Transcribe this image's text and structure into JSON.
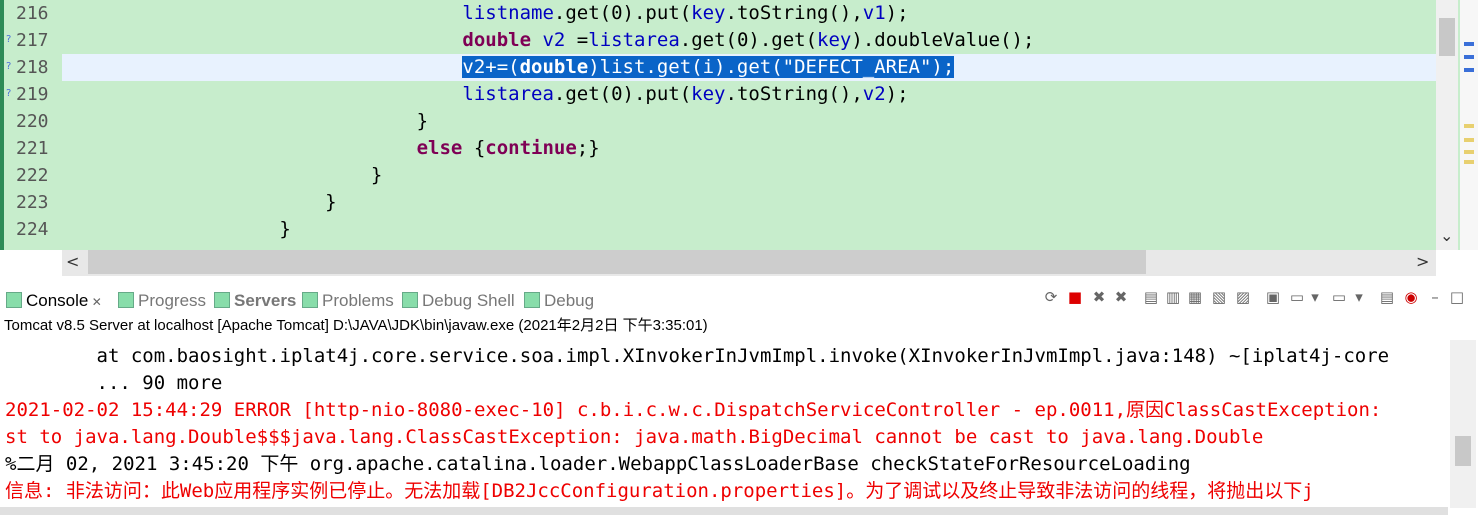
{
  "editor": {
    "line_numbers": [
      "216",
      "217",
      "218",
      "219",
      "220",
      "221",
      "222",
      "223",
      "224"
    ],
    "lines": [
      {
        "indent": "                                   ",
        "parts": [
          {
            "t": "listname",
            "c": "fld"
          },
          {
            "t": ".get(0).put(",
            "c": ""
          },
          {
            "t": "key",
            "c": "fld"
          },
          {
            "t": ".toString(),",
            "c": ""
          },
          {
            "t": "v1",
            "c": "fld"
          },
          {
            "t": ");",
            "c": ""
          }
        ]
      },
      {
        "indent": "                                   ",
        "parts": [
          {
            "t": "double",
            "c": "kw"
          },
          {
            "t": " ",
            "c": ""
          },
          {
            "t": "v2",
            "c": "fld"
          },
          {
            "t": " =",
            "c": ""
          },
          {
            "t": "listarea",
            "c": "fld"
          },
          {
            "t": ".get(0).get(",
            "c": ""
          },
          {
            "t": "key",
            "c": "fld"
          },
          {
            "t": ").doubleValue();",
            "c": ""
          }
        ]
      },
      {
        "indent": "                                   ",
        "parts": [
          {
            "t": "v2+=(",
            "c": "sel"
          },
          {
            "t": "double",
            "c": "sel kwsel"
          },
          {
            "t": ")list.get(i).get(\"DEFECT_AREA\");",
            "c": "sel"
          }
        ],
        "current": true
      },
      {
        "indent": "                                   ",
        "parts": [
          {
            "t": "listarea",
            "c": "fld"
          },
          {
            "t": ".get(0).put(",
            "c": ""
          },
          {
            "t": "key",
            "c": "fld"
          },
          {
            "t": ".toString(),",
            "c": ""
          },
          {
            "t": "v2",
            "c": "fld"
          },
          {
            "t": ");",
            "c": ""
          }
        ]
      },
      {
        "indent": "                               ",
        "parts": [
          {
            "t": "}",
            "c": ""
          }
        ]
      },
      {
        "indent": "                               ",
        "parts": [
          {
            "t": "else",
            "c": "kw"
          },
          {
            "t": " {",
            "c": ""
          },
          {
            "t": "continue",
            "c": "kw"
          },
          {
            "t": ";}",
            "c": ""
          }
        ]
      },
      {
        "indent": "                           ",
        "parts": [
          {
            "t": "}",
            "c": ""
          }
        ]
      },
      {
        "indent": "                       ",
        "parts": [
          {
            "t": "}",
            "c": ""
          }
        ]
      },
      {
        "indent": "                   ",
        "parts": [
          {
            "t": "}",
            "c": ""
          }
        ]
      }
    ]
  },
  "tabs": [
    {
      "label": "Console",
      "active": true,
      "icon": "console-icon"
    },
    {
      "label": "Progress",
      "active": false,
      "icon": "progress-icon"
    },
    {
      "label": "Servers",
      "active": false,
      "icon": "servers-icon"
    },
    {
      "label": "Problems",
      "active": false,
      "icon": "problems-icon"
    },
    {
      "label": "Debug Shell",
      "active": false,
      "icon": "debug-shell-icon"
    },
    {
      "label": "Debug",
      "active": false,
      "icon": "debug-icon"
    }
  ],
  "launch_info": "Tomcat v8.5 Server at localhost [Apache Tomcat] D:\\JAVA\\JDK\\bin\\javaw.exe (2021年2月2日 下午3:35:01)",
  "console_lines": [
    {
      "text": "        at com.baosight.iplat4j.core.service.soa.impl.XInvokerInJvmImpl.invoke(XInvokerInJvmImpl.java:148) ~[iplat4j-core",
      "color": "b"
    },
    {
      "text": "        ... 90 more",
      "color": "b"
    },
    {
      "text": "2021-02-02 15:44:29 ERROR [http-nio-8080-exec-10] c.b.i.c.w.c.DispatchServiceController - ep.0011,原因ClassCastException:",
      "color": "r"
    },
    {
      "text": "st to java.lang.Double$$$java.lang.ClassCastException: java.math.BigDecimal cannot be cast to java.lang.Double",
      "color": "r"
    },
    {
      "text": "%二月 02, 2021 3:45:20 下午 org.apache.catalina.loader.WebappClassLoaderBase checkStateForResourceLoading",
      "color": "b"
    },
    {
      "text": "信息: 非法访问：此Web应用程序实例已停止。无法加载[DB2JccConfiguration.properties]。为了调试以及终止导致非法访问的线程，将抛出以下j",
      "color": "r"
    }
  ],
  "colors": {
    "editor_bg": "#c7edcc",
    "selection": "#0a64c8",
    "error_text": "#e00000"
  }
}
